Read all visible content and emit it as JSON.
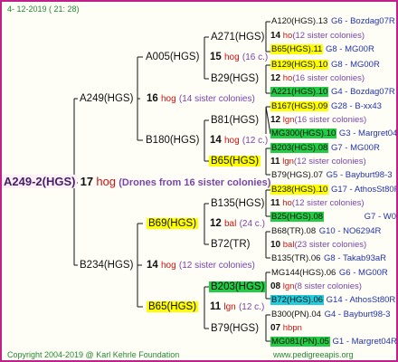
{
  "header": {
    "date": "4- 12-2019 ( 21: 28)"
  },
  "footer": {
    "copyright": "Copyright 2004-2019 @ Karl Kehrle Foundation",
    "site": "www.pedigreeapis.org"
  },
  "root": {
    "name": "A249-2(HGS)",
    "count": "17",
    "unit": "hog",
    "note": "(Drones from 16 sister colonies)"
  },
  "gen1": {
    "upper": {
      "name": "A249(HGS)",
      "count": "16",
      "unit": "hog",
      "note": "(14 sister colonies)"
    },
    "lower": {
      "name": "B234(HGS)",
      "count": "14",
      "unit": "hog",
      "note": "(12 sister colonies)"
    }
  },
  "gen2": {
    "a005": {
      "name": "A005(HGS)",
      "count": "15",
      "unit": "hog",
      "note": "(16 c.)"
    },
    "b180": {
      "name": "B180(HGS)",
      "count": "14",
      "unit": "hog",
      "note": "(12 c.)"
    },
    "b69": {
      "name": "B69(HGS)",
      "count": "12",
      "unit": "bal",
      "note": "(24 c.)"
    },
    "b65": {
      "name": "B65(HGS)",
      "count": "11",
      "unit": "lgn",
      "note": "(12 c.)"
    }
  },
  "gen3": {
    "a271": "A271(HGS)",
    "b29": "B29(HGS)",
    "b81": "B81(HGS)",
    "b65": "B65(HGS)",
    "b135": "B135(HGS)",
    "b72": "B72(TR)",
    "b203": "B203(HGS)",
    "b79": "B79(HGS)"
  },
  "gen4": [
    {
      "text": "A120(HGS).13",
      "loc": "G6 - Bozdag07R"
    },
    {
      "count": "14",
      "unit": "ho",
      "note": "(12 sister colonies)"
    },
    {
      "text": "B65(HGS).11",
      "loc": "G8 - MG00R"
    },
    {
      "text": "B129(HGS).10",
      "loc": "G8 - MG00R"
    },
    {
      "count": "12",
      "unit": "ho",
      "note": "(16 sister colonies)"
    },
    {
      "text": "A221(HGS).10",
      "loc": "G4 - Bozdag07R"
    },
    {
      "text": "B167(HGS).09",
      "loc": "G28 - B-xx43"
    },
    {
      "count": "12",
      "unit": "lgn",
      "note": "(16 sister colonies)"
    },
    {
      "text": "MG300(HGS).10",
      "loc": "G3 - Margret04R"
    },
    {
      "text": "B203(HGS).08",
      "loc": "G7 - MG00R"
    },
    {
      "count": "11",
      "unit": "lgn",
      "note": "(12 sister colonies)"
    },
    {
      "text": "B79(HGS).07",
      "loc": "G5 - Bayburt98-3"
    },
    {
      "text": "B238(HGS).10",
      "loc": "G17 - AthosSt80R"
    },
    {
      "count": "11",
      "unit": "ho",
      "note": "(12 sister colonies)"
    },
    {
      "text": "B25(HGS).08",
      "loc": "G7 - W0"
    },
    {
      "text": "B68(TR).08",
      "loc": "G10 - NO6294R"
    },
    {
      "count": "10",
      "unit": "bal",
      "note": "(23 sister colonies)"
    },
    {
      "text": "B135(TR).06",
      "loc": "G8 - Takab93aR"
    },
    {
      "text": "MG144(HGS).06",
      "loc": "G6 - MG00R"
    },
    {
      "count": "08",
      "unit": "lgn",
      "note": "(8 sister colonies)"
    },
    {
      "text": "B72(HGS).06",
      "loc": "G14 - AthosSt80R"
    },
    {
      "text": "B300(PN).04",
      "loc": "G4 - Bayburt98-3"
    },
    {
      "count": "07",
      "unit": "hbpn",
      "note": ""
    },
    {
      "text": "MG081(PN).05",
      "loc": "G1 - Margret04R"
    }
  ],
  "colors": {
    "frame": "#c0208a",
    "yellow": "#ffff00",
    "green": "#22cc44",
    "cyan": "#22ccdd",
    "hog": "#cc1111",
    "note": "#7744aa",
    "loc": "#2233aa"
  }
}
